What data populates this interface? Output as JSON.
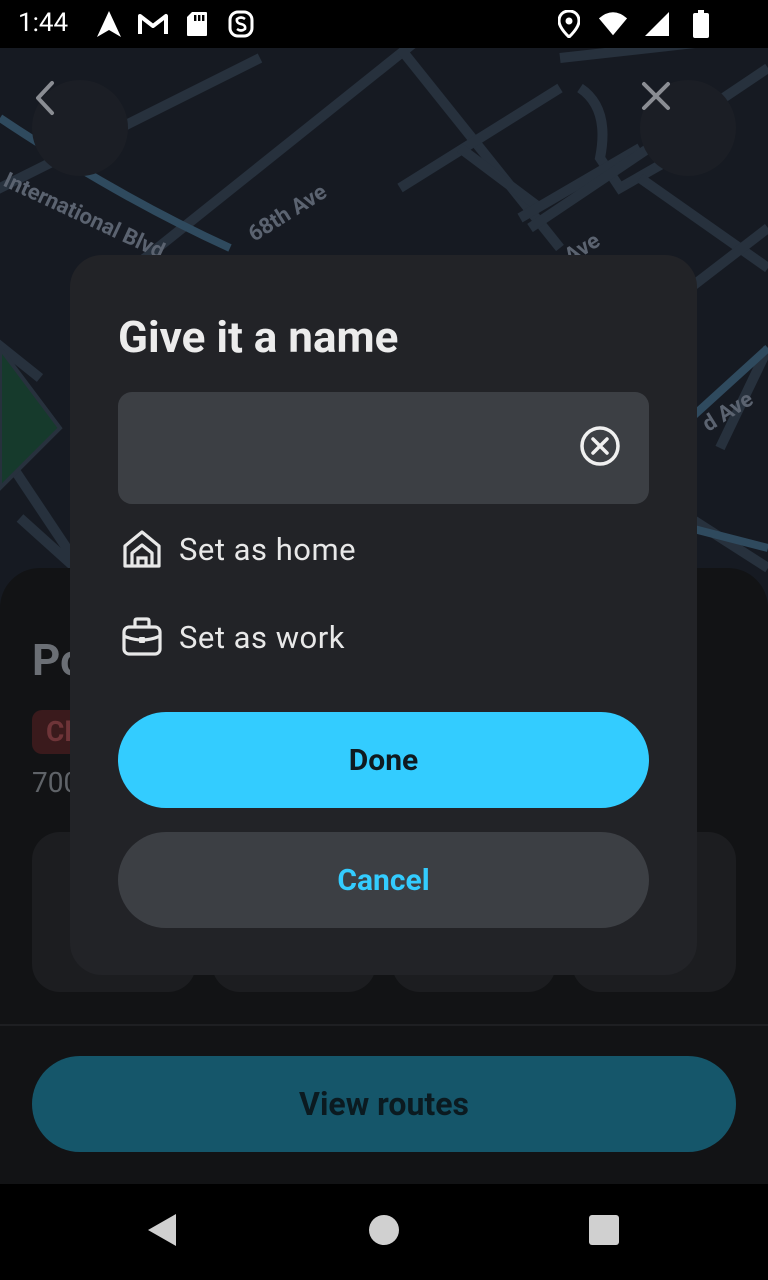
{
  "status_bar": {
    "time": "1:44",
    "left_icons": [
      "navigation-icon",
      "gmail-icon",
      "sd-card-icon",
      "app-s-icon"
    ],
    "right_icons": [
      "location-icon",
      "wifi-icon",
      "signal-icon",
      "battery-icon"
    ]
  },
  "map": {
    "labels": [
      "International Blvd",
      "68th Ave",
      "Ave",
      "d Ave"
    ]
  },
  "background_sheet": {
    "title_fragment": "Po",
    "badge_fragment": "Cl",
    "address_fragment": "700",
    "view_routes_label": "View routes"
  },
  "dialog": {
    "title": "Give it a name",
    "input": {
      "value": "",
      "placeholder": ""
    },
    "options": [
      {
        "label": "Set as home",
        "icon": "home-icon"
      },
      {
        "label": "Set as work",
        "icon": "briefcase-icon"
      }
    ],
    "done_label": "Done",
    "cancel_label": "Cancel"
  },
  "colors": {
    "accent": "#33ccff",
    "dialog_bg": "#222327",
    "input_bg": "#3c3f44",
    "map_bg": "#161a22"
  }
}
